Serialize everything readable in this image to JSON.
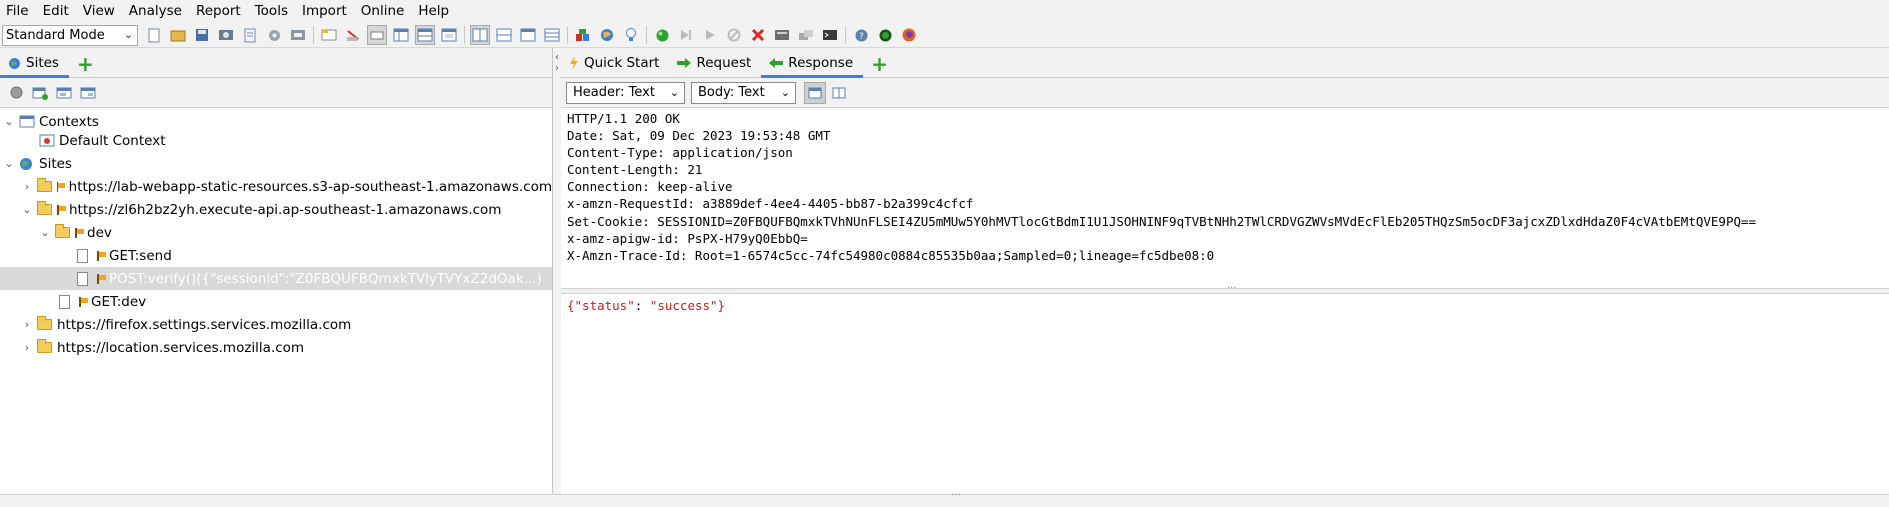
{
  "menubar": {
    "items": [
      "File",
      "Edit",
      "View",
      "Analyse",
      "Report",
      "Tools",
      "Import",
      "Online",
      "Help"
    ]
  },
  "toolbar": {
    "mode": "Standard Mode"
  },
  "left": {
    "tab_label": "Sites",
    "tree": [
      {
        "label": "Contexts"
      },
      {
        "label": "Default Context"
      },
      {
        "label": "Sites"
      },
      {
        "label": "https://lab-webapp-static-resources.s3-ap-southeast-1.amazonaws.com"
      },
      {
        "label": "https://zl6h2bz2yh.execute-api.ap-southeast-1.amazonaws.com"
      },
      {
        "label": "dev"
      },
      {
        "label": "GET:send"
      },
      {
        "label": "POST:verify()({\"sessionid\":\"Z0FBQUFBQmxkTVlyTVYxZ2dOak...)"
      },
      {
        "label": "GET:dev"
      },
      {
        "label": "https://firefox.settings.services.mozilla.com"
      },
      {
        "label": "https://location.services.mozilla.com"
      }
    ]
  },
  "right": {
    "tabs": {
      "quick_start": "Quick Start",
      "request": "Request",
      "response": "Response"
    },
    "header_format": "Header: Text",
    "body_format": "Body: Text",
    "response_headers": [
      "HTTP/1.1 200 OK",
      "Date: Sat, 09 Dec 2023 19:53:48 GMT",
      "Content-Type: application/json",
      "Content-Length: 21",
      "Connection: keep-alive",
      "x-amzn-RequestId: a3889def-4ee4-4405-bb87-b2a399c4cfcf",
      "Set-Cookie: SESSIONID=Z0FBQUFBQmxkTVhNUnFLSEI4ZU5mMUw5Y0hMVTlocGtBdmI1U1JSOHNINF9qTVBtNHh2TWlCRDVGZWVsMVdEcFlEb205THQzSm5ocDF3ajcxZDlxdHdaZ0F4cVAtbEMtQVE9PQ==",
      "x-amz-apigw-id: PsPX-H79yQ0EbbQ=",
      "X-Amzn-Trace-Id: Root=1-6574c5cc-74fc54980c0884c85535b0aa;Sampled=0;lineage=fc5dbe08:0"
    ],
    "body": {
      "open": "{",
      "key": "\"status\"",
      "colon": ": ",
      "value": "\"success\"",
      "close": "}"
    }
  },
  "colors": {
    "accent": "#3d7fd6",
    "json": "#c02020",
    "add_green": "#2ea12e"
  }
}
